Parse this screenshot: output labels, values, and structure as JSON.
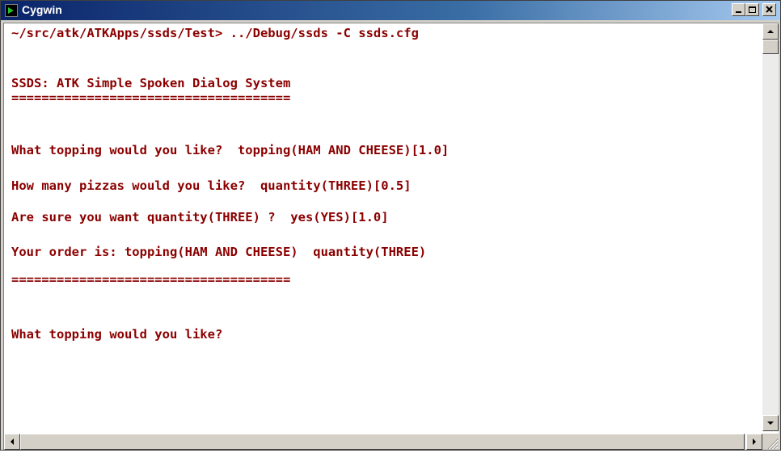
{
  "window": {
    "title": "Cygwin"
  },
  "console": {
    "lines": [
      "~/src/atk/ATKApps/ssds/Test> ../Debug/ssds -C ssds.cfg",
      "SSDS: ATK Simple Spoken Dialog System",
      "=====================================",
      "What topping would you like?  topping(HAM AND CHEESE)[1.0]",
      "How many pizzas would you like?  quantity(THREE)[0.5]",
      "Are sure you want quantity(THREE) ?  yes(YES)[1.0]",
      "Your order is: topping(HAM AND CHEESE)  quantity(THREE)",
      "=====================================",
      "What topping would you like?"
    ]
  },
  "icons": {
    "app": "cygwin-icon",
    "minimize": "minimize-icon",
    "maximize": "maximize-icon",
    "close": "close-icon"
  },
  "colors": {
    "text": "#8b0000",
    "titlebar": "#0a246a",
    "background": "#ffffff"
  }
}
